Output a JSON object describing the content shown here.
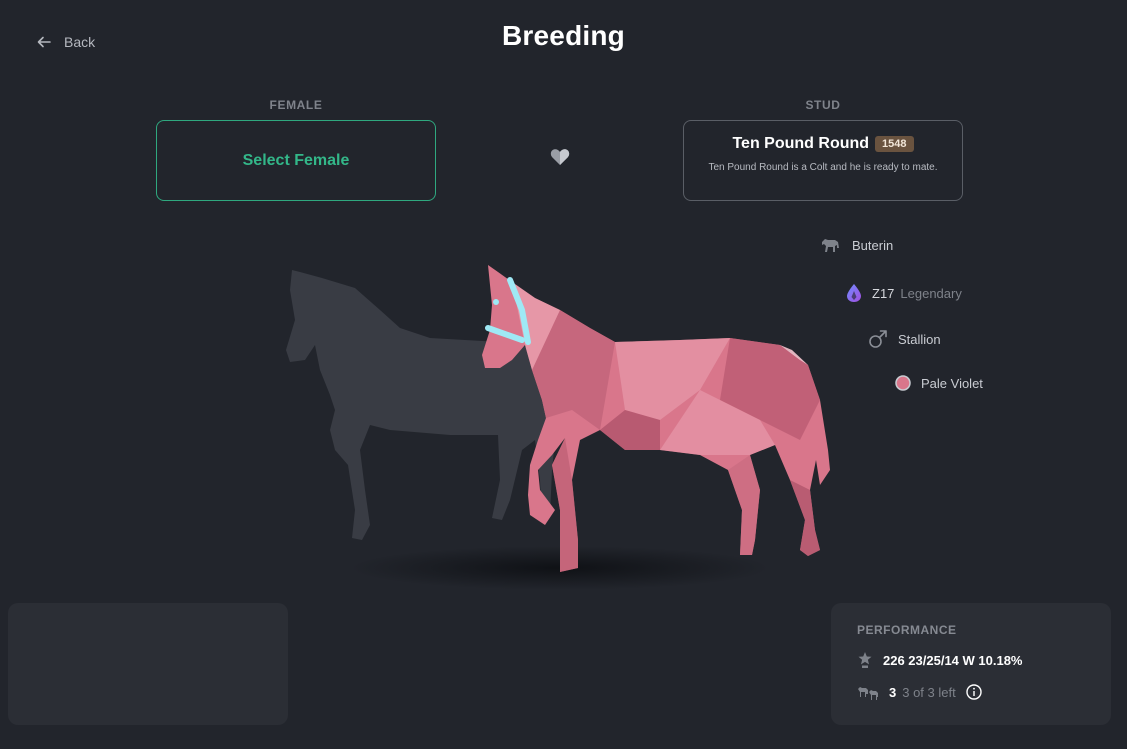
{
  "header": {
    "back_label": "Back",
    "title": "Breeding"
  },
  "female": {
    "section_label": "FEMALE",
    "select_label": "Select Female"
  },
  "stud": {
    "section_label": "STUD",
    "name": "Ten Pound Round",
    "badge": "1548",
    "description": "Ten Pound Round is a Colt and he is ready to mate."
  },
  "attributes": {
    "bloodline": "Buterin",
    "genotype": "Z17",
    "rarity": "Legendary",
    "gender": "Stallion",
    "color_name": "Pale Violet",
    "color_hex": "#d9768b"
  },
  "performance": {
    "title": "PERFORMANCE",
    "stats": "226 23/25/14 W 10.18%",
    "offspring_count": "3",
    "offspring_left": "3 of 3 left"
  },
  "colors": {
    "accent_green": "#33b789",
    "horse_pink": "#d9768b",
    "bridle": "#9fe9f5",
    "background": "#22252c"
  }
}
